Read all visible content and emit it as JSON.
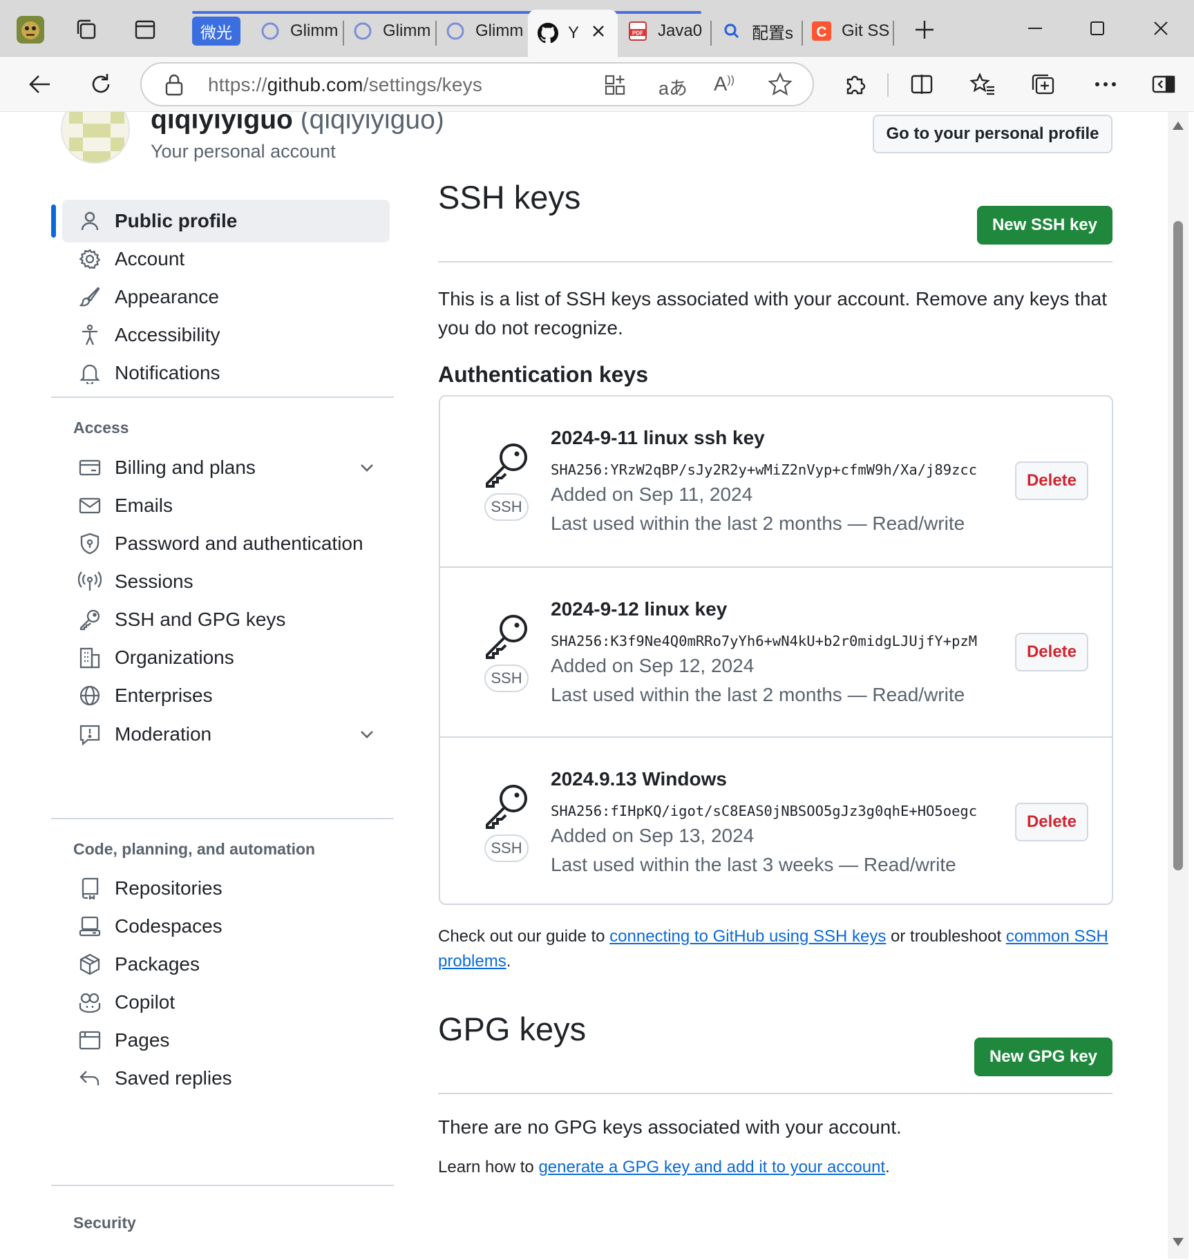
{
  "browser": {
    "tabs": [
      {
        "label": "微光",
        "type": "group"
      },
      {
        "label": "Glimm"
      },
      {
        "label": "Glimm"
      },
      {
        "label": "Glimm"
      },
      {
        "label": "Y",
        "active": true
      },
      {
        "label": "Java0"
      },
      {
        "label": "配置s"
      },
      {
        "label": "Git SS"
      }
    ],
    "url": {
      "scheme": "https://",
      "host": "github.com",
      "path": "/settings/keys"
    }
  },
  "profile": {
    "name": "qiqiyiyiguo",
    "handle": "(qiqiyiyiguo)",
    "subtitle": "Your personal account",
    "go_button": "Go to your personal profile"
  },
  "sidebar": {
    "top_items": [
      {
        "label": "Public profile",
        "icon": "person-icon"
      },
      {
        "label": "Account",
        "icon": "gear-icon"
      },
      {
        "label": "Appearance",
        "icon": "paintbrush-icon"
      },
      {
        "label": "Accessibility",
        "icon": "accessibility-icon"
      },
      {
        "label": "Notifications",
        "icon": "bell-icon"
      }
    ],
    "access_heading": "Access",
    "access_items": [
      {
        "label": "Billing and plans",
        "icon": "credit-card-icon"
      },
      {
        "label": "Emails",
        "icon": "mail-icon"
      },
      {
        "label": "Password and authentication",
        "icon": "shield-lock-icon"
      },
      {
        "label": "Sessions",
        "icon": "broadcast-icon"
      },
      {
        "label": "SSH and GPG keys",
        "icon": "key-icon"
      },
      {
        "label": "Organizations",
        "icon": "organization-icon"
      },
      {
        "label": "Enterprises",
        "icon": "globe-icon"
      },
      {
        "label": "Moderation",
        "icon": "report-icon"
      }
    ],
    "code_heading": "Code, planning, and automation",
    "code_items": [
      {
        "label": "Repositories",
        "icon": "repo-icon"
      },
      {
        "label": "Codespaces",
        "icon": "codespaces-icon"
      },
      {
        "label": "Packages",
        "icon": "package-icon"
      },
      {
        "label": "Copilot",
        "icon": "copilot-icon"
      },
      {
        "label": "Pages",
        "icon": "browser-icon"
      },
      {
        "label": "Saved replies",
        "icon": "reply-icon"
      }
    ],
    "security_heading": "Security"
  },
  "ssh": {
    "heading": "SSH keys",
    "new_button": "New SSH key",
    "intro": "This is a list of SSH keys associated with your account. Remove any keys that you do not recognize.",
    "auth_heading": "Authentication keys",
    "badge": "SSH",
    "delete_label": "Delete",
    "keys": [
      {
        "title": "2024-9-11 linux ssh key",
        "fingerprint": "SHA256:YRzW2qBP/sJy2R2y+wMiZ2nVyp+cfmW9h/Xa/j89zcc",
        "added": "Added on Sep 11, 2024",
        "used": "Last used within the last 2 months — Read/write"
      },
      {
        "title": "2024-9-12 linux key",
        "fingerprint": "SHA256:K3f9Ne4Q0mRRo7yYh6+wN4kU+b2r0midgLJUjfY+pzM",
        "added": "Added on Sep 12, 2024",
        "used": "Last used within the last 2 months — Read/write"
      },
      {
        "title": "2024.9.13 Windows",
        "fingerprint": "SHA256:fIHpKQ/igot/sC8EAS0jNBSOO5gJz3g0qhE+HO5oegc",
        "added": "Added on Sep 13, 2024",
        "used": "Last used within the last 3 weeks — Read/write"
      }
    ],
    "guide_prefix": "Check out our guide to ",
    "guide_link1": "connecting to GitHub using SSH keys",
    "guide_middle": " or troubleshoot ",
    "guide_link2": "common SSH problems",
    "guide_suffix": "."
  },
  "gpg": {
    "heading": "GPG keys",
    "new_button": "New GPG key",
    "empty": "There are no GPG keys associated with your account.",
    "learn_prefix": "Learn how to ",
    "learn_link": "generate a GPG key and add it to your account",
    "learn_suffix": "."
  },
  "colors": {
    "primary_green": "#1f883d",
    "danger_red": "#d1242f",
    "link_blue": "#0969da",
    "active_indicator": "#0969da"
  }
}
